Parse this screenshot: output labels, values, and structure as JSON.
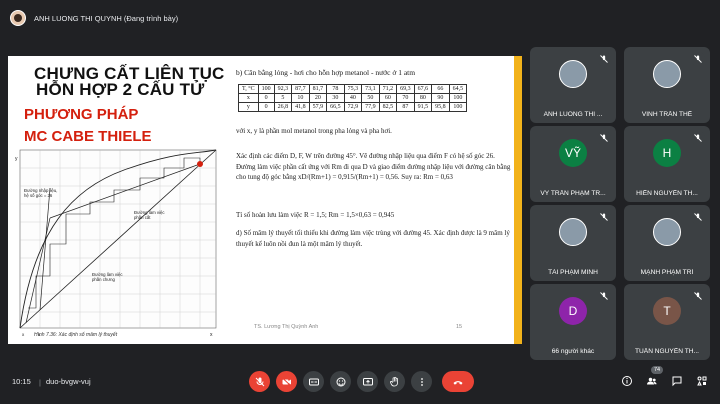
{
  "presenter": {
    "label": "ANH LUONG THI QUYNH (Đang trình bày)"
  },
  "slide": {
    "title_line1": "CHƯNG CẤT LIÊN TỤC",
    "title_line2": "HỖN HỢP 2 CẤU TỬ",
    "subtitle1": "PHƯƠNG PHÁP",
    "subtitle2": "MC CABE THIELE",
    "graph_labels": {
      "feed_line": "Đường nhập liệu,\nhệ số góc = 26",
      "rect_line": "Đường làm việc\nphần cất",
      "strip_line": "Đường làm việc\nphần chưng"
    },
    "caption": "Hình 7.36: Xác định số mâm lý thuyết",
    "heading": "b) Cân bằng lỏng - hơi cho hỗn hợp metanol - nước ở 1 atm",
    "table": {
      "rows": [
        [
          "T, °C",
          "100",
          "92,3",
          "87,7",
          "81,7",
          "78",
          "75,3",
          "73,1",
          "71,2",
          "69,3",
          "67,6",
          "66",
          "64,5"
        ],
        [
          "x",
          "0",
          "5",
          "10",
          "20",
          "30",
          "40",
          "50",
          "60",
          "70",
          "80",
          "90",
          "100"
        ],
        [
          "y",
          "0",
          "26,8",
          "41,8",
          "57,9",
          "66,5",
          "72,9",
          "77,9",
          "82,5",
          "87",
          "91,5",
          "95,8",
          "100"
        ]
      ]
    },
    "p1": "với x, y là phần mol metanol trong pha lỏng và pha hơi.",
    "p2": "Xác định các điểm D, F, W trên đường 45°. Vẽ đường nhập liệu qua điểm F có hệ số góc 26. Đường làm việc phần cất ứng với Rm đi qua D và giao điểm đường nhập liệu với đường cân bằng cho tung độ góc bằng xD/(Rm+1) = 0,915/(Rm+1) = 0,56. Suy ra: Rm = 0,63",
    "p3": "Tỉ số hoàn lưu làm việc R = 1,5; Rm = 1,5×0,63 = 0,945",
    "p4": "d) Số mâm lý thuyết tối thiểu khi đường làm việc trùng với đường 45. Xác định được là 9 mâm lý thuyết kể luôn nồi đun là một mâm lý thuyết.",
    "footer_name": "TS. Lương Thị Quỳnh Anh",
    "slide_number": "15"
  },
  "participants": [
    {
      "name": "ANH LUONG THI ...",
      "avatar": "photo",
      "color": "#3c4043"
    },
    {
      "name": "VINH TRẦN THẾ",
      "avatar": "photo",
      "color": "#3c4043"
    },
    {
      "name": "VỸ TRẦN PHẠM TR...",
      "avatar": "VỸ",
      "color": "#0b8043"
    },
    {
      "name": "HIỀN NGUYỄN TH...",
      "avatar": "H",
      "color": "#0b8043"
    },
    {
      "name": "TÀI PHẠM MINH",
      "avatar": "photo",
      "color": "#3c4043"
    },
    {
      "name": "MẠNH PHẠM TRÍ",
      "avatar": "photo",
      "color": "#3c4043"
    },
    {
      "name": "66 người khác",
      "avatar": "D",
      "color": "#8e24aa"
    },
    {
      "name": "TUẤN NGUYỄN TH...",
      "avatar": "T",
      "color": "#795548"
    }
  ],
  "bottom": {
    "time": "10:15",
    "divider": "|",
    "meeting_code": "duo-bvgw-vuj",
    "participant_count": "74"
  }
}
